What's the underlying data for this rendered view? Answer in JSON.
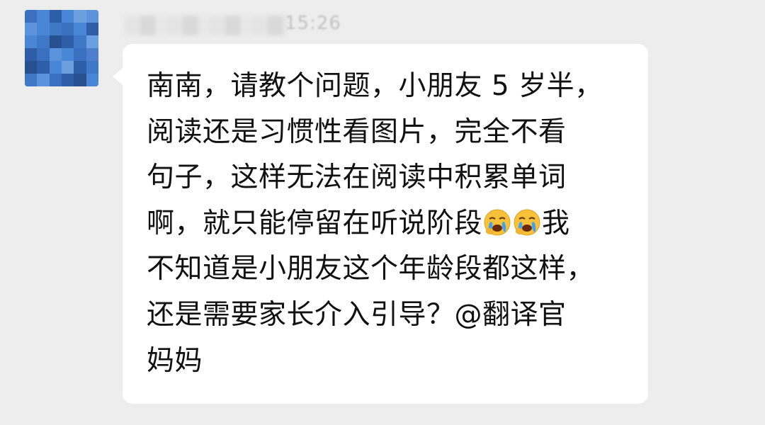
{
  "chat": {
    "sender": {
      "name": "",
      "time": "15:26"
    },
    "message": {
      "line1": "南南，请教个问题，小朋友 5 岁半，",
      "line2": "阅读还是习惯性看图片，完全不看",
      "line3": "句子，这样无法在阅读中积累单词",
      "line4_a": "啊，就只能停留在听说阶段",
      "line4_b": "我",
      "line5": "不知道是小朋友这个年龄段都这样，",
      "line6": "还是需要家长介入引导？@翻译官",
      "line7": "妈妈",
      "emojis": [
        "crying-face-icon",
        "crying-face-icon"
      ]
    }
  },
  "colors": {
    "background": "#ededed",
    "bubble": "#ffffff",
    "text": "#111111",
    "avatar_main": "#3f78c6"
  }
}
